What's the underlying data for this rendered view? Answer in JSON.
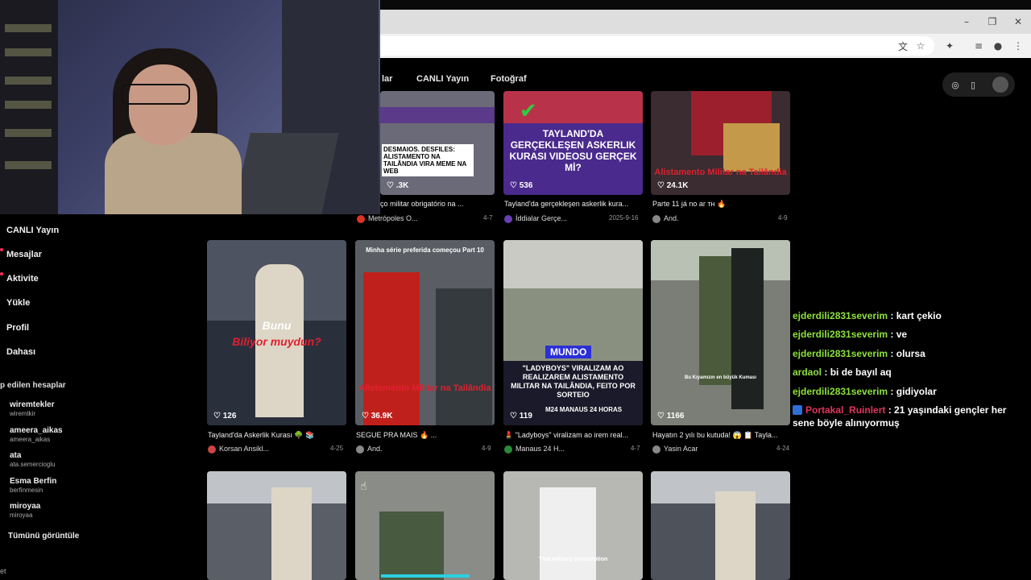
{
  "browser": {
    "window_controls": {
      "minimize": "–",
      "restore": "❐",
      "close": "✕"
    }
  },
  "site_nav": {
    "items": [
      "lar",
      "CANLI Yayın",
      "Fotoğraf"
    ]
  },
  "sidebar": {
    "items": [
      {
        "label": "CANLI Yayın",
        "dot": false
      },
      {
        "label": "Mesajlar",
        "dot": true
      },
      {
        "label": "Aktivite",
        "dot": true
      },
      {
        "label": "Yükle",
        "dot": false
      },
      {
        "label": "Profil",
        "dot": false
      },
      {
        "label": "Dahası",
        "dot": false
      }
    ],
    "following_header": "p edilen hesaplar",
    "accounts": [
      {
        "name": "wiremtekler",
        "user": "wiremtkir"
      },
      {
        "name": "ameera_aikas",
        "user": "ameera_aikas"
      },
      {
        "name": "ata",
        "user": "ata.semercioglu"
      },
      {
        "name": "Esma Berfin",
        "user": "berfinmesin"
      },
      {
        "name": "miroyaa",
        "user": "miroyaa"
      }
    ],
    "see_all": "Tümünü görüntüle",
    "bottom_text": "et"
  },
  "videos": {
    "row1": [
      {
        "overlay": "DESMAIOS. DESFILES: ALISTAMENTO NA TAILÂNDIA VIRA MEME NA WEB",
        "likes": ".3K",
        "caption": "ço militar obrigatório na ...",
        "author": "Metrópoles O...",
        "date": "4-7"
      },
      {
        "overlay": "TAYLAND'DA GERÇEKLEŞEN ASKERLIK KURASI VIDEOSU GERÇEK Mİ?",
        "likes": "536",
        "caption": "Tayland'da gerçekleşen askerlik kura...",
        "author": "İddialar Gerçe...",
        "date": "2025-9-16"
      },
      {
        "overlay": "Alistamento Militar na Tailândia",
        "likes": "24.1K",
        "caption": "Parte 11 já no ar ᴛʜ 🔥",
        "author": "And.",
        "date": "4-9"
      }
    ],
    "row2": [
      {
        "overlay1": "Bunu",
        "overlay2": "Biliyor muydun?",
        "likes": "126",
        "caption": "Tayland'da Askerlik Kurası 🌳 📚",
        "author": "Korsan Ansikl...",
        "date": "4-25"
      },
      {
        "overlay_top": "Minha série preferida começou Part 10",
        "overlay": "Alistamento Militar na Tailândia",
        "likes": "36.9K",
        "caption": "SEGUE PRA MAIS 🔥 ...",
        "author": "And.",
        "date": "4-9"
      },
      {
        "overlay_tag": "MUNDO",
        "overlay": "\"LADYBOYS\" VIRALIZAM AO REALIZAREM ALISTAMENTO MILITAR NA TAILÂNDIA, FEITO POR SORTEIO",
        "brand": "M24 MANAUS 24 HORAS",
        "likes": "119",
        "caption": "💄 \"Ladyboys\" viralizam ao irem real...",
        "author": "Manaus 24 H...",
        "date": "4-7"
      },
      {
        "overlay": "Bu Kıyamızın en büyük Kuması",
        "likes": "1166",
        "caption": "Hayatın 2 yılı bu kutuda! 😱 📋 Tayla...",
        "author": "Yasin Acar",
        "date": "4-24"
      }
    ],
    "row3": [
      {
        "overlay": ""
      },
      {
        "overlay": ""
      },
      {
        "overlay": "That military conscription"
      },
      {
        "overlay": ""
      }
    ]
  },
  "chat": [
    {
      "user": "ejderdili2831severim",
      "msg": ": kart çekio",
      "badge": false,
      "red": false
    },
    {
      "user": "ejderdili2831severim",
      "msg": ": ve",
      "badge": false,
      "red": false
    },
    {
      "user": "ejderdili2831severim",
      "msg": ": olursa",
      "badge": false,
      "red": false
    },
    {
      "user": "ardaol",
      "msg": ": bi de bayıl aq",
      "badge": false,
      "red": false
    },
    {
      "user": "ejderdili2831severim",
      "msg": ": gidiyolar",
      "badge": false,
      "red": false
    },
    {
      "user": "Portakal_Ruinlert",
      "msg": ": 21 yaşındaki gençler her sene böyle alınıyormuş",
      "badge": true,
      "red": true
    }
  ],
  "colors": {
    "chat_user": "#8ee03c",
    "chat_user_alt": "#e0365c",
    "accent": "#fe2c55"
  }
}
